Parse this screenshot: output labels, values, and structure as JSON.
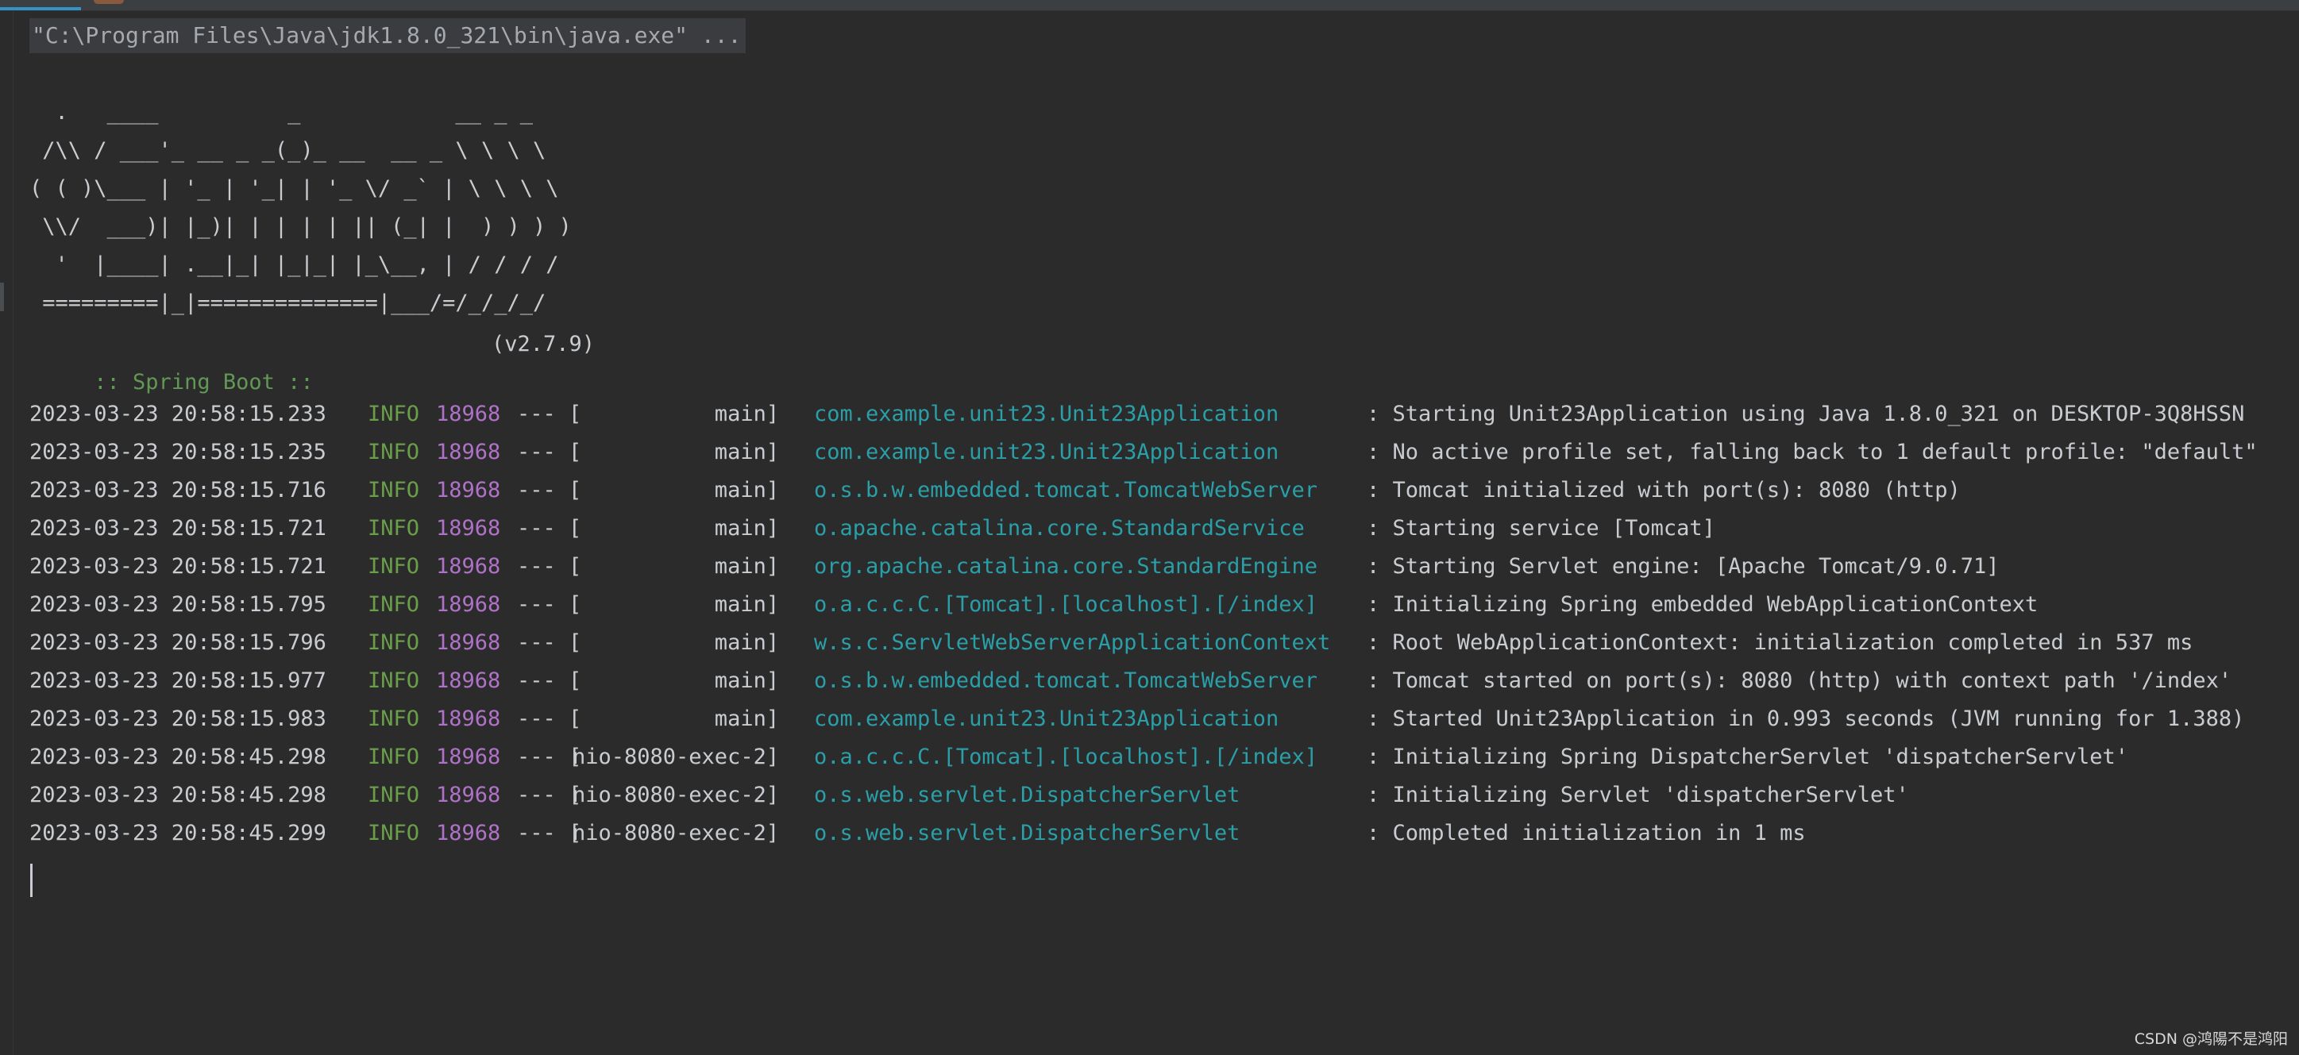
{
  "command_line": "\"C:\\Program Files\\Java\\jdk1.8.0_321\\bin\\java.exe\" ...",
  "banner": [
    "  .   ____          _            __ _ _",
    " /\\\\ / ___'_ __ _ _(_)_ __  __ _ \\ \\ \\ \\",
    "( ( )\\___ | '_ | '_| | '_ \\/ _` | \\ \\ \\ \\",
    " \\\\/  ___)| |_)| | | | | || (_| |  ) ) ) )",
    "  '  |____| .__|_| |_|_| |_\\__, | / / / /",
    " =========|_|==============|___/=/_/_/_/"
  ],
  "spring_boot": {
    "tag": " :: Spring Boot :: ",
    "version": "(v2.7.9)"
  },
  "logs": [
    {
      "timestamp": "2023-03-23 20:58:15.233",
      "level": "INFO",
      "pid": "18968",
      "sep": "--- [",
      "thread": "           main]",
      "logger": "com.example.unit23.Unit23Application",
      "message": ": Starting Unit23Application using Java 1.8.0_321 on DESKTOP-3Q8HSSN"
    },
    {
      "timestamp": "2023-03-23 20:58:15.235",
      "level": "INFO",
      "pid": "18968",
      "sep": "--- [",
      "thread": "           main]",
      "logger": "com.example.unit23.Unit23Application",
      "message": ": No active profile set, falling back to 1 default profile: \"default\""
    },
    {
      "timestamp": "2023-03-23 20:58:15.716",
      "level": "INFO",
      "pid": "18968",
      "sep": "--- [",
      "thread": "           main]",
      "logger": "o.s.b.w.embedded.tomcat.TomcatWebServer",
      "message": ": Tomcat initialized with port(s): 8080 (http)"
    },
    {
      "timestamp": "2023-03-23 20:58:15.721",
      "level": "INFO",
      "pid": "18968",
      "sep": "--- [",
      "thread": "           main]",
      "logger": "o.apache.catalina.core.StandardService",
      "message": ": Starting service [Tomcat]"
    },
    {
      "timestamp": "2023-03-23 20:58:15.721",
      "level": "INFO",
      "pid": "18968",
      "sep": "--- [",
      "thread": "           main]",
      "logger": "org.apache.catalina.core.StandardEngine",
      "message": ": Starting Servlet engine: [Apache Tomcat/9.0.71]"
    },
    {
      "timestamp": "2023-03-23 20:58:15.795",
      "level": "INFO",
      "pid": "18968",
      "sep": "--- [",
      "thread": "           main]",
      "logger": "o.a.c.c.C.[Tomcat].[localhost].[/index]",
      "message": ": Initializing Spring embedded WebApplicationContext"
    },
    {
      "timestamp": "2023-03-23 20:58:15.796",
      "level": "INFO",
      "pid": "18968",
      "sep": "--- [",
      "thread": "           main]",
      "logger": "w.s.c.ServletWebServerApplicationContext",
      "message": ": Root WebApplicationContext: initialization completed in 537 ms"
    },
    {
      "timestamp": "2023-03-23 20:58:15.977",
      "level": "INFO",
      "pid": "18968",
      "sep": "--- [",
      "thread": "           main]",
      "logger": "o.s.b.w.embedded.tomcat.TomcatWebServer",
      "message": ": Tomcat started on port(s): 8080 (http) with context path '/index'"
    },
    {
      "timestamp": "2023-03-23 20:58:15.983",
      "level": "INFO",
      "pid": "18968",
      "sep": "--- [",
      "thread": "           main]",
      "logger": "com.example.unit23.Unit23Application",
      "message": ": Started Unit23Application in 0.993 seconds (JVM running for 1.388)"
    },
    {
      "timestamp": "2023-03-23 20:58:45.298",
      "level": "INFO",
      "pid": "18968",
      "sep": "--- [",
      "thread": "nio-8080-exec-2]",
      "logger": "o.a.c.c.C.[Tomcat].[localhost].[/index]",
      "message": ": Initializing Spring DispatcherServlet 'dispatcherServlet'"
    },
    {
      "timestamp": "2023-03-23 20:58:45.298",
      "level": "INFO",
      "pid": "18968",
      "sep": "--- [",
      "thread": "nio-8080-exec-2]",
      "logger": "o.s.web.servlet.DispatcherServlet",
      "message": ": Initializing Servlet 'dispatcherServlet'"
    },
    {
      "timestamp": "2023-03-23 20:58:45.299",
      "level": "INFO",
      "pid": "18968",
      "sep": "--- [",
      "thread": "nio-8080-exec-2]",
      "logger": "o.s.web.servlet.DispatcherServlet",
      "message": ": Completed initialization in 1 ms"
    }
  ],
  "watermark": "CSDN @鸿陽不是鸿阳",
  "colors": {
    "background": "#2b2b2b",
    "text": "#c9ccd0",
    "level_info": "#6a9e49",
    "pid": "#b072c8",
    "logger": "#2a9fa8",
    "spring_boot_tag": "#629755"
  }
}
